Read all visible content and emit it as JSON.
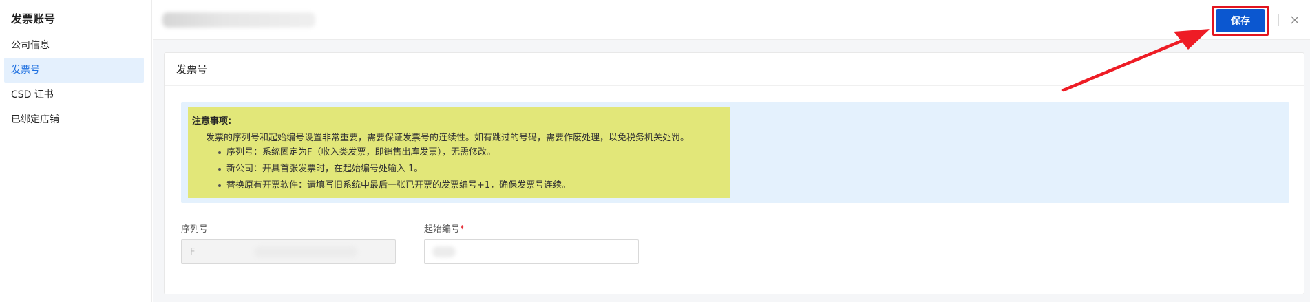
{
  "sidebar": {
    "title": "发票账号",
    "items": [
      {
        "label": "公司信息",
        "active": false
      },
      {
        "label": "发票号",
        "active": true
      },
      {
        "label": "CSD 证书",
        "active": false
      },
      {
        "label": "已绑定店铺",
        "active": false
      }
    ]
  },
  "topbar": {
    "save_label": "保存"
  },
  "card": {
    "title": "发票号",
    "notice": {
      "heading": "注意事项:",
      "description": "发票的序列号和起始编号设置非常重要，需要保证发票号的连续性。如有跳过的号码，需要作废处理，以免税务机关处罚。",
      "bullets": [
        "序列号：系统固定为F（收入类发票，即销售出库发票），无需修改。",
        "新公司：开具首张发票时，在起始编号处输入 1。",
        "替换原有开票软件：请填写旧系统中最后一张已开票的发票编号+1，确保发票号连续。"
      ]
    },
    "fields": {
      "serial": {
        "label": "序列号",
        "value": "F"
      },
      "start_number": {
        "label": "起始编号",
        "required_mark": "*"
      }
    }
  },
  "colors": {
    "primary": "#0b57d0",
    "highlight_border": "#e2151f",
    "notice_bg": "#e4f1fd",
    "notice_highlight": "#e2e779",
    "active_nav_bg": "#e4f0fd"
  }
}
